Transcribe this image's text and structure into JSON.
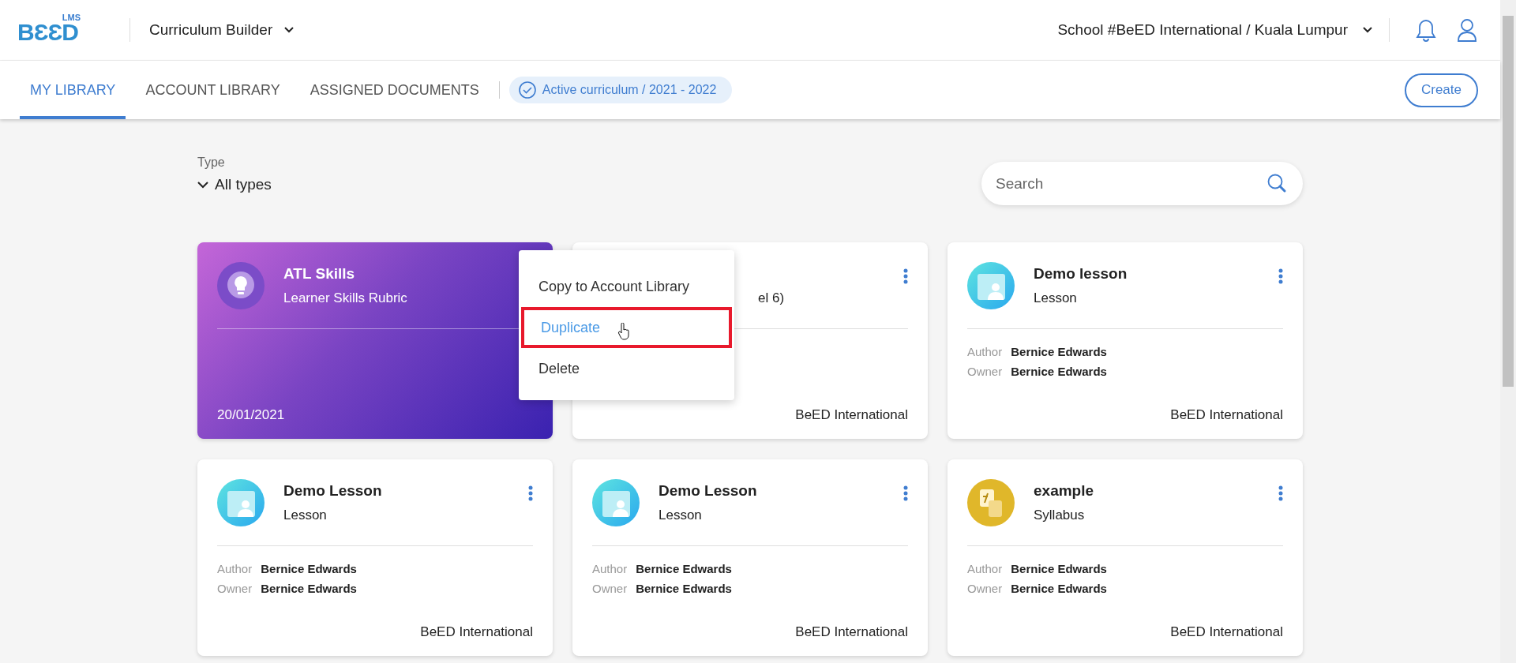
{
  "header": {
    "logo": {
      "mark": "BƐƐD",
      "sub": "LMS"
    },
    "app_switcher": "Curriculum Builder",
    "school": "School #BeED International / Kuala Lumpur"
  },
  "tabs": [
    {
      "label": "MY LIBRARY",
      "selected": true
    },
    {
      "label": "ACCOUNT LIBRARY",
      "selected": false
    },
    {
      "label": "ASSIGNED DOCUMENTS",
      "selected": false
    }
  ],
  "active_curriculum": "Active curriculum / 2021 - 2022",
  "create_button": "Create",
  "filter": {
    "label": "Type",
    "value": "All types"
  },
  "search": {
    "placeholder": "Search"
  },
  "cards": [
    {
      "kind": "rubric",
      "title": "ATL Skills",
      "subtitle": "Learner Skills Rubric",
      "date": "20/01/2021"
    },
    {
      "kind": "covered",
      "subtitle": "el 6)",
      "school": "BeED International"
    },
    {
      "kind": "lesson",
      "title": "Demo lesson",
      "subtitle": "Lesson",
      "author_label": "Author",
      "author": "Bernice Edwards",
      "owner_label": "Owner",
      "owner": "Bernice Edwards",
      "school": "BeED International"
    },
    {
      "kind": "lesson",
      "title": "Demo Lesson",
      "subtitle": "Lesson",
      "author_label": "Author",
      "author": "Bernice Edwards",
      "owner_label": "Owner",
      "owner": "Bernice Edwards",
      "school": "BeED International"
    },
    {
      "kind": "lesson",
      "title": "Demo Lesson",
      "subtitle": "Lesson",
      "author_label": "Author",
      "author": "Bernice Edwards",
      "owner_label": "Owner",
      "owner": "Bernice Edwards",
      "school": "BeED International"
    },
    {
      "kind": "syllabus",
      "title": "example",
      "subtitle": "Syllabus",
      "author_label": "Author",
      "author": "Bernice Edwards",
      "owner_label": "Owner",
      "owner": "Bernice Edwards",
      "school": "BeED International"
    }
  ],
  "context_menu": [
    {
      "label": "Copy to Account Library",
      "selected": false
    },
    {
      "label": "Duplicate",
      "selected": true
    },
    {
      "label": "Delete",
      "selected": false
    }
  ]
}
